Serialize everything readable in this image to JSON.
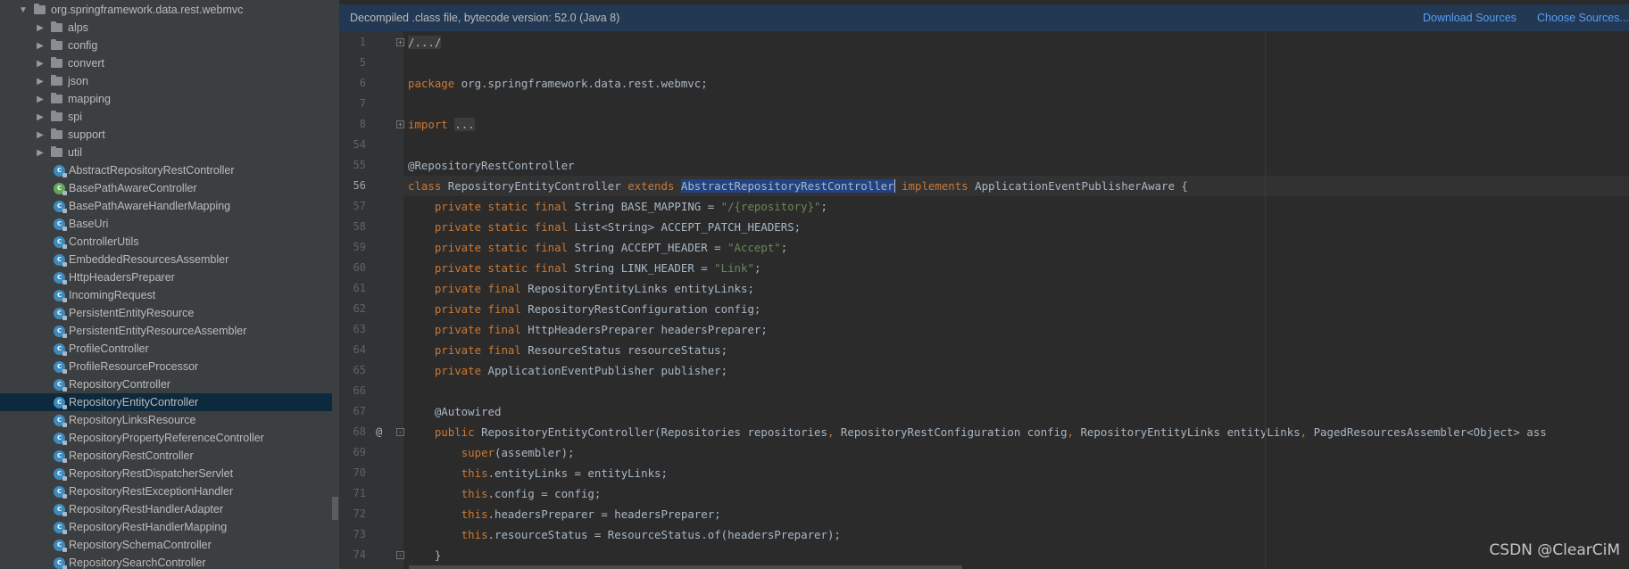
{
  "tree": {
    "root": "org.springframework.data.rest.webmvc",
    "packages": [
      "alps",
      "config",
      "convert",
      "json",
      "mapping",
      "spi",
      "support",
      "util"
    ],
    "classes": [
      {
        "name": "AbstractRepositoryRestController",
        "icon": "class-icon",
        "color": "#3c8bbf"
      },
      {
        "name": "BasePathAwareController",
        "icon": "annotation-class-icon",
        "color": "#62a65a"
      },
      {
        "name": "BasePathAwareHandlerMapping",
        "icon": "class-icon",
        "color": "#3c8bbf"
      },
      {
        "name": "BaseUri",
        "icon": "class-icon",
        "color": "#3c8bbf"
      },
      {
        "name": "ControllerUtils",
        "icon": "class-icon",
        "color": "#3c8bbf"
      },
      {
        "name": "EmbeddedResourcesAssembler",
        "icon": "class-icon",
        "color": "#3c8bbf"
      },
      {
        "name": "HttpHeadersPreparer",
        "icon": "class-icon",
        "color": "#3c8bbf"
      },
      {
        "name": "IncomingRequest",
        "icon": "class-icon",
        "color": "#3c8bbf"
      },
      {
        "name": "PersistentEntityResource",
        "icon": "class-icon",
        "color": "#3c8bbf"
      },
      {
        "name": "PersistentEntityResourceAssembler",
        "icon": "class-icon",
        "color": "#3c8bbf"
      },
      {
        "name": "ProfileController",
        "icon": "class-icon",
        "color": "#3c8bbf"
      },
      {
        "name": "ProfileResourceProcessor",
        "icon": "class-icon",
        "color": "#3c8bbf"
      },
      {
        "name": "RepositoryController",
        "icon": "class-icon",
        "color": "#3c8bbf"
      },
      {
        "name": "RepositoryEntityController",
        "icon": "class-icon",
        "color": "#3c8bbf",
        "selected": true
      },
      {
        "name": "RepositoryLinksResource",
        "icon": "class-icon",
        "color": "#3c8bbf"
      },
      {
        "name": "RepositoryPropertyReferenceController",
        "icon": "class-icon",
        "color": "#3c8bbf"
      },
      {
        "name": "RepositoryRestController",
        "icon": "class-icon",
        "color": "#3c8bbf"
      },
      {
        "name": "RepositoryRestDispatcherServlet",
        "icon": "class-icon",
        "color": "#3c8bbf"
      },
      {
        "name": "RepositoryRestExceptionHandler",
        "icon": "class-icon",
        "color": "#3c8bbf"
      },
      {
        "name": "RepositoryRestHandlerAdapter",
        "icon": "class-icon",
        "color": "#3c8bbf"
      },
      {
        "name": "RepositoryRestHandlerMapping",
        "icon": "class-icon",
        "color": "#3c8bbf"
      },
      {
        "name": "RepositorySchemaController",
        "icon": "class-icon",
        "color": "#3c8bbf"
      },
      {
        "name": "RepositorySearchController",
        "icon": "class-icon",
        "color": "#3c8bbf"
      }
    ]
  },
  "banner": {
    "text": "Decompiled .class file, bytecode version: 52.0 (Java 8)",
    "download_sources": "Download Sources",
    "choose_sources": "Choose Sources..."
  },
  "editor": {
    "active_line": "56",
    "lines": [
      {
        "n": "1",
        "fold": "+",
        "parts": [
          {
            "t": "/.../",
            "c": "fold-ph"
          }
        ]
      },
      {
        "n": "5",
        "parts": []
      },
      {
        "n": "6",
        "parts": [
          {
            "t": "package",
            "c": "kw"
          },
          {
            "t": " org.springframework.data.rest.webmvc;"
          }
        ]
      },
      {
        "n": "7",
        "parts": []
      },
      {
        "n": "8",
        "fold": "+",
        "parts": [
          {
            "t": "import",
            "c": "kw"
          },
          {
            "t": " "
          },
          {
            "t": "...",
            "c": "fold-ph"
          }
        ]
      },
      {
        "n": "54",
        "parts": []
      },
      {
        "n": "55",
        "parts": [
          {
            "t": "@RepositoryRestController"
          }
        ]
      },
      {
        "n": "56",
        "caret": true,
        "parts": [
          {
            "t": "class",
            "c": "kw"
          },
          {
            "t": " RepositoryEntityController "
          },
          {
            "t": "extends",
            "c": "kw"
          },
          {
            "t": " "
          },
          {
            "t": "AbstractRepositoryRestController",
            "c": "sel"
          },
          {
            "t": " ",
            "c": "cursor"
          },
          {
            "t": "implements",
            "c": "kw"
          },
          {
            "t": " ApplicationEventPublisherAware {"
          }
        ]
      },
      {
        "n": "57",
        "parts": [
          {
            "t": "    "
          },
          {
            "t": "private static final",
            "c": "kw"
          },
          {
            "t": " String BASE_MAPPING = "
          },
          {
            "t": "\"/{repository}\"",
            "c": "str"
          },
          {
            "t": ";"
          }
        ]
      },
      {
        "n": "58",
        "parts": [
          {
            "t": "    "
          },
          {
            "t": "private static final",
            "c": "kw"
          },
          {
            "t": " List<String> ACCEPT_PATCH_HEADERS;"
          }
        ]
      },
      {
        "n": "59",
        "parts": [
          {
            "t": "    "
          },
          {
            "t": "private static final",
            "c": "kw"
          },
          {
            "t": " String ACCEPT_HEADER = "
          },
          {
            "t": "\"Accept\"",
            "c": "str"
          },
          {
            "t": ";"
          }
        ]
      },
      {
        "n": "60",
        "parts": [
          {
            "t": "    "
          },
          {
            "t": "private static final",
            "c": "kw"
          },
          {
            "t": " String LINK_HEADER = "
          },
          {
            "t": "\"Link\"",
            "c": "str"
          },
          {
            "t": ";"
          }
        ]
      },
      {
        "n": "61",
        "parts": [
          {
            "t": "    "
          },
          {
            "t": "private final",
            "c": "kw"
          },
          {
            "t": " RepositoryEntityLinks entityLinks;"
          }
        ]
      },
      {
        "n": "62",
        "parts": [
          {
            "t": "    "
          },
          {
            "t": "private final",
            "c": "kw"
          },
          {
            "t": " RepositoryRestConfiguration config;"
          }
        ]
      },
      {
        "n": "63",
        "parts": [
          {
            "t": "    "
          },
          {
            "t": "private final",
            "c": "kw"
          },
          {
            "t": " HttpHeadersPreparer headersPreparer;"
          }
        ]
      },
      {
        "n": "64",
        "parts": [
          {
            "t": "    "
          },
          {
            "t": "private final",
            "c": "kw"
          },
          {
            "t": " ResourceStatus resourceStatus;"
          }
        ]
      },
      {
        "n": "65",
        "parts": [
          {
            "t": "    "
          },
          {
            "t": "private",
            "c": "kw"
          },
          {
            "t": " ApplicationEventPublisher publisher;"
          }
        ]
      },
      {
        "n": "66",
        "parts": []
      },
      {
        "n": "67",
        "parts": [
          {
            "t": "    @Autowired"
          }
        ]
      },
      {
        "n": "68",
        "marker": "@",
        "fold": "-",
        "parts": [
          {
            "t": "    "
          },
          {
            "t": "public",
            "c": "kw"
          },
          {
            "t": " RepositoryEntityController(Repositories repositories"
          },
          {
            "t": ",",
            "c": "kw"
          },
          {
            "t": " RepositoryRestConfiguration config"
          },
          {
            "t": ",",
            "c": "kw"
          },
          {
            "t": " RepositoryEntityLinks entityLinks"
          },
          {
            "t": ",",
            "c": "kw"
          },
          {
            "t": " PagedResourcesAssembler<Object> ass"
          }
        ]
      },
      {
        "n": "69",
        "parts": [
          {
            "t": "        "
          },
          {
            "t": "super",
            "c": "kw"
          },
          {
            "t": "(assembler);"
          }
        ]
      },
      {
        "n": "70",
        "parts": [
          {
            "t": "        "
          },
          {
            "t": "this",
            "c": "kw"
          },
          {
            "t": ".entityLinks = entityLinks;"
          }
        ]
      },
      {
        "n": "71",
        "parts": [
          {
            "t": "        "
          },
          {
            "t": "this",
            "c": "kw"
          },
          {
            "t": ".config = config;"
          }
        ]
      },
      {
        "n": "72",
        "parts": [
          {
            "t": "        "
          },
          {
            "t": "this",
            "c": "kw"
          },
          {
            "t": ".headersPreparer = headersPreparer;"
          }
        ]
      },
      {
        "n": "73",
        "parts": [
          {
            "t": "        "
          },
          {
            "t": "this",
            "c": "kw"
          },
          {
            "t": ".resourceStatus = ResourceStatus.of(headersPreparer);"
          }
        ]
      },
      {
        "n": "74",
        "fold": "-",
        "parts": [
          {
            "t": "    }"
          }
        ]
      }
    ]
  },
  "watermark": "CSDN @ClearCiM"
}
